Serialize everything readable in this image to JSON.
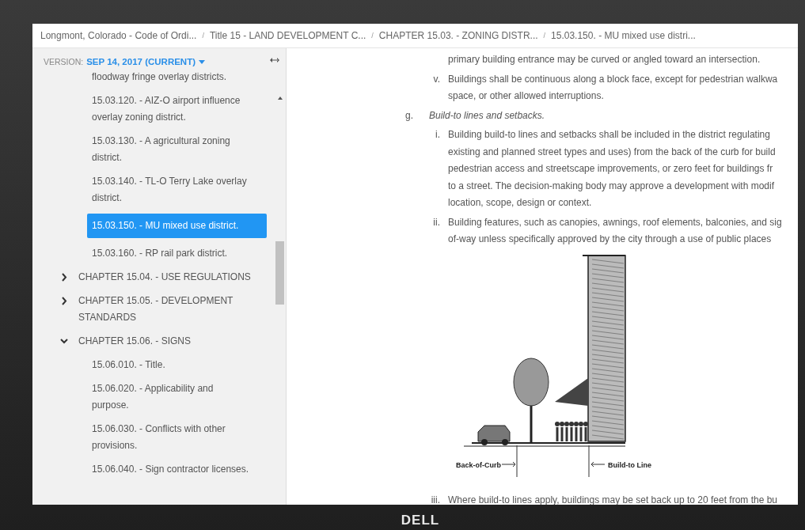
{
  "breadcrumbs": [
    {
      "label": "Longmont, Colorado - Code of Ordi..."
    },
    {
      "separator": "/",
      "label": "Title 15 - LAND DEVELOPMENT C..."
    },
    {
      "separator": "/",
      "label": "CHAPTER 15.03. - ZONING DISTR..."
    },
    {
      "separator": "/",
      "label": "15.03.150. - MU mixed use distri..."
    }
  ],
  "sidebar": {
    "version_label": "VERSION:",
    "version_value": "SEP 14, 2017 (CURRENT)",
    "items": [
      {
        "label": "floodway fringe overlay districts.",
        "selected": false
      },
      {
        "label": "15.03.120. - AIZ-O airport influence overlay zoning district.",
        "selected": false
      },
      {
        "label": "15.03.130. - A agricultural zoning district.",
        "selected": false
      },
      {
        "label": "15.03.140. - TL-O Terry Lake overlay district.",
        "selected": false
      },
      {
        "label": "15.03.150. - MU mixed use district.",
        "selected": true
      },
      {
        "label": "15.03.160. - RP rail park district.",
        "selected": false
      }
    ],
    "chapters": [
      {
        "label": "CHAPTER 15.04. - USE REGULATIONS",
        "expanded": false
      },
      {
        "label": "CHAPTER 15.05. - DEVELOPMENT STANDARDS",
        "expanded": false
      },
      {
        "label": "CHAPTER 15.06. - SIGNS",
        "expanded": true,
        "children": [
          {
            "label": "15.06.010. - Title.",
            "selected": false
          },
          {
            "label": "15.06.020. - Applicability and purpose.",
            "selected": false
          },
          {
            "label": "15.06.030. - Conflicts with other provisions.",
            "selected": false
          },
          {
            "label": "15.06.040. - Sign contractor licenses.",
            "selected": false
          }
        ]
      }
    ]
  },
  "content": {
    "blocks": [
      {
        "kind": "item",
        "lines": [
          "primary building entrance may be curved or angled toward an intersection."
        ]
      },
      {
        "kind": "item",
        "marker": "v.",
        "lines": [
          "Buildings shall be continuous along a block face, except for pedestrian walkwa",
          "space, or other allowed interruptions."
        ]
      },
      {
        "kind": "heading",
        "marker": "g.",
        "lines": [
          "Build-to lines and setbacks."
        ]
      },
      {
        "kind": "item",
        "marker": "i.",
        "lines": [
          "Building build-to lines and setbacks shall be included in the district regulating",
          "existing and planned street types and uses) from the back of the curb for build",
          "pedestrian access and streetscape improvements, or zero feet for buildings fr",
          "to a street. The decision-making body may approve a development with modif",
          "location, scope, design or context."
        ]
      },
      {
        "kind": "item",
        "marker": "ii.",
        "lines": [
          "Building features, such as canopies, awnings, roof elements, balconies, and sig",
          "of-way unless specifically approved by the city through a use of public places"
        ]
      },
      {
        "kind": "figure",
        "labels": [
          "Back-of-Curb",
          "Build-to Line"
        ]
      },
      {
        "kind": "item",
        "marker": "iii.",
        "lines": [
          "Where build-to lines apply, buildings may be set back up to 20 feet from the bu"
        ]
      }
    ]
  },
  "monitor": {
    "logo": "DELL"
  }
}
